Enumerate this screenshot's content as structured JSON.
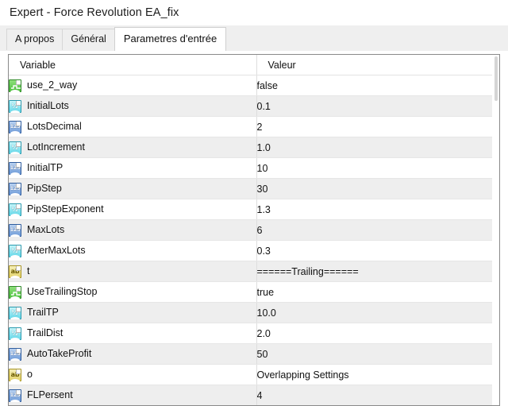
{
  "window": {
    "title": "Expert - Force Revolution EA_fix"
  },
  "tabs": [
    {
      "label": "A propos",
      "selected": false,
      "name": "tab-a-propos"
    },
    {
      "label": "Général",
      "selected": false,
      "name": "tab-general"
    },
    {
      "label": "Parametres d'entrée",
      "selected": true,
      "name": "tab-parametres-dentree"
    }
  ],
  "grid": {
    "columns": [
      {
        "key": "variable",
        "label": "Variable"
      },
      {
        "key": "valeur",
        "label": "Valeur"
      }
    ],
    "rows": [
      {
        "icon": "bool-type-icon",
        "type": "bool",
        "variable": "use_2_way",
        "valeur": "false"
      },
      {
        "icon": "double-type-icon",
        "type": "double",
        "variable": "InitialLots",
        "valeur": "0.1"
      },
      {
        "icon": "int-type-icon",
        "type": "int",
        "variable": "LotsDecimal",
        "valeur": "2"
      },
      {
        "icon": "double-type-icon",
        "type": "double",
        "variable": "LotIncrement",
        "valeur": "1.0"
      },
      {
        "icon": "int-type-icon",
        "type": "int",
        "variable": "InitialTP",
        "valeur": "10"
      },
      {
        "icon": "int-type-icon",
        "type": "int",
        "variable": "PipStep",
        "valeur": "30"
      },
      {
        "icon": "double-type-icon",
        "type": "double",
        "variable": "PipStepExponent",
        "valeur": "1.3"
      },
      {
        "icon": "int-type-icon",
        "type": "int",
        "variable": "MaxLots",
        "valeur": "6"
      },
      {
        "icon": "double-type-icon",
        "type": "double",
        "variable": "AfterMaxLots",
        "valeur": "0.3"
      },
      {
        "icon": "string-type-icon",
        "type": "string",
        "variable": "t",
        "valeur": "======Trailing======"
      },
      {
        "icon": "bool-type-icon",
        "type": "bool",
        "variable": "UseTrailingStop",
        "valeur": "true"
      },
      {
        "icon": "double-type-icon",
        "type": "double",
        "variable": "TrailTP",
        "valeur": "10.0"
      },
      {
        "icon": "double-type-icon",
        "type": "double",
        "variable": "TrailDist",
        "valeur": "2.0"
      },
      {
        "icon": "int-type-icon",
        "type": "int",
        "variable": "AutoTakeProfit",
        "valeur": "50"
      },
      {
        "icon": "string-type-icon",
        "type": "string",
        "variable": "o",
        "valeur": "Overlapping Settings"
      },
      {
        "icon": "int-type-icon",
        "type": "int",
        "variable": "FLPersent",
        "valeur": "4"
      }
    ]
  },
  "icon_glyphs": {
    "bool": "",
    "double": "½",
    "int": "123",
    "string": "ab"
  },
  "colors": {
    "window_bg": "#ffffff",
    "tabstrip_bg": "#efefef",
    "grid_border": "#8a8a8a",
    "row_alt_bg": "#eeeeee",
    "row_bg": "#ffffff",
    "text": "#111111",
    "icon_bool": "#4cbf3e",
    "icon_double": "#63d7e8",
    "icon_int": "#6f9bd8",
    "icon_string": "#e2d26a"
  }
}
